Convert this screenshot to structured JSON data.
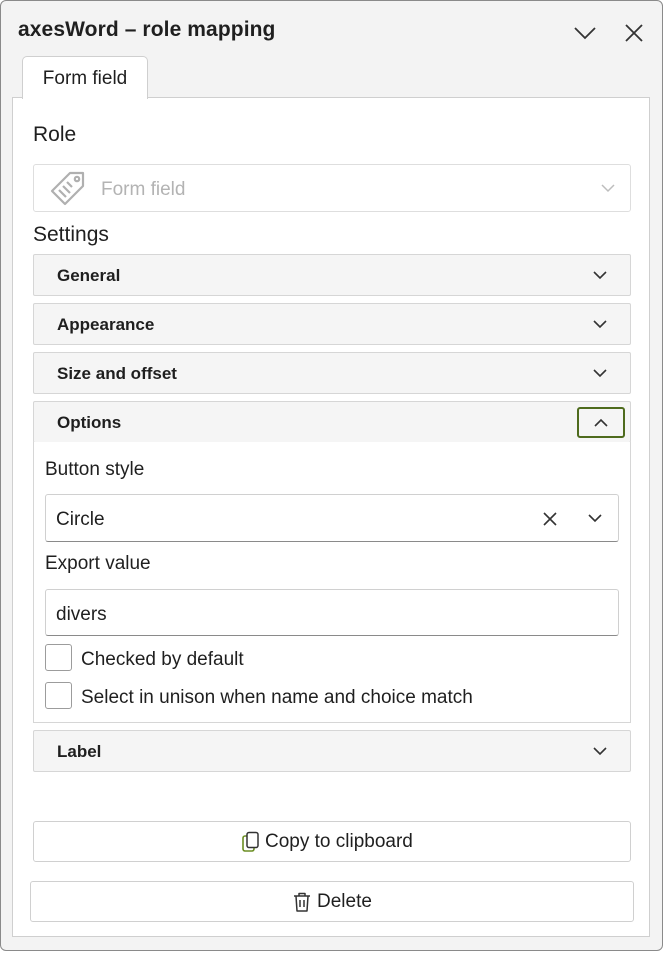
{
  "window": {
    "title": "axesWord – role mapping",
    "collapse_icon": "chevron-down-icon",
    "close_icon": "close-icon"
  },
  "tabs": [
    {
      "label": "Form field",
      "active": true
    }
  ],
  "role": {
    "heading": "Role",
    "value": "Form field",
    "icon": "form-field-icon"
  },
  "settings": {
    "heading": "Settings",
    "sections": {
      "general": "General",
      "appearance": "Appearance",
      "size_offset": "Size and offset",
      "options": "Options",
      "label": "Label"
    },
    "options": {
      "button_style_label": "Button style",
      "button_style_value": "Circle",
      "export_value_label": "Export value",
      "export_value": "divers",
      "checked_by_default_label": "Checked by default",
      "checked_by_default": false,
      "unison_label": "Select in unison when name and choice match",
      "unison": false
    }
  },
  "actions": {
    "copy_label": "Copy to clipboard",
    "delete_label": "Delete"
  },
  "colors": {
    "focus_border": "#4e6b1d",
    "copy_icon": "#6b8e23"
  }
}
